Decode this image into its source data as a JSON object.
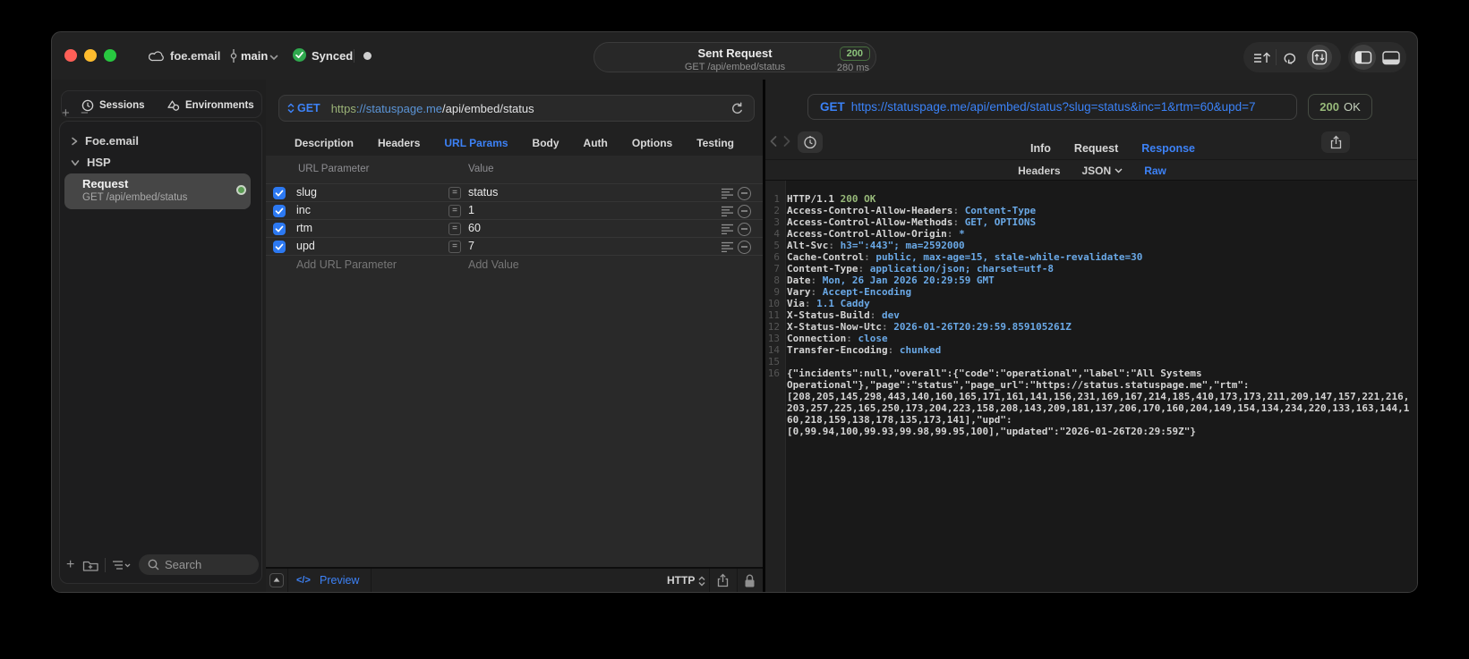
{
  "titlebar": {
    "project": "foe.email",
    "branch": "main",
    "sync_status": "Synced",
    "center": {
      "title": "Sent Request",
      "subtitle": "GET /api/embed/status",
      "status_code": "200",
      "duration": "280 ms"
    }
  },
  "sidebar": {
    "tabs": [
      {
        "label": "Sessions"
      },
      {
        "label": "Environments"
      }
    ],
    "tree": [
      {
        "label": "Foe.email"
      },
      {
        "label": "HSP"
      }
    ],
    "request_item": {
      "title": "Request",
      "subtitle": "GET /api/embed/status"
    },
    "search_placeholder": "Search"
  },
  "request_pane": {
    "method": "GET",
    "url_scheme": "https",
    "url_host": "://statuspage.me",
    "url_path": "/api/embed/status",
    "tabs": [
      "Description",
      "Headers",
      "URL Params",
      "Body",
      "Auth",
      "Options",
      "Testing"
    ],
    "active_tab": "URL Params",
    "table": {
      "col1": "URL Parameter",
      "col2": "Value",
      "rows": [
        {
          "name": "slug",
          "value": "status"
        },
        {
          "name": "inc",
          "value": "1"
        },
        {
          "name": "rtm",
          "value": "60"
        },
        {
          "name": "upd",
          "value": "7"
        }
      ],
      "add_name": "Add URL Parameter",
      "add_value": "Add Value"
    },
    "footer": {
      "code_glyph": "</>",
      "preview_label": "Preview",
      "protocol": "HTTP"
    }
  },
  "response_pane": {
    "method": "GET",
    "url": "https://statuspage.me/api/embed/status?slug=status&inc=1&rtm=60&upd=7",
    "status_code": "200",
    "status_text": "OK",
    "tabs": [
      "Info",
      "Request",
      "Response"
    ],
    "active_tab": "Response",
    "subtabs": [
      "Headers",
      "JSON",
      "Raw"
    ],
    "active_subtab": "Raw",
    "http_line": {
      "protocol": "HTTP/1.1",
      "status": "200 OK"
    },
    "headers": [
      {
        "name": "Access-Control-Allow-Headers",
        "value": "Content-Type"
      },
      {
        "name": "Access-Control-Allow-Methods",
        "value": "GET, OPTIONS"
      },
      {
        "name": "Access-Control-Allow-Origin",
        "value": "*"
      },
      {
        "name": "Alt-Svc",
        "value": "h3=\":443\"; ma=2592000"
      },
      {
        "name": "Cache-Control",
        "value": "public, max-age=15, stale-while-revalidate=30"
      },
      {
        "name": "Content-Type",
        "value": "application/json; charset=utf-8"
      },
      {
        "name": "Date",
        "value": "Mon, 26 Jan 2026 20:29:59 GMT"
      },
      {
        "name": "Vary",
        "value": "Accept-Encoding"
      },
      {
        "name": "Via",
        "value": "1.1 Caddy"
      },
      {
        "name": "X-Status-Build",
        "value": "dev"
      },
      {
        "name": "X-Status-Now-Utc",
        "value": "2026-01-26T20:29:59.859105261Z"
      },
      {
        "name": "Connection",
        "value": "close"
      },
      {
        "name": "Transfer-Encoding",
        "value": "chunked"
      }
    ],
    "body_lines": [
      "{\"incidents\":null,\"overall\":{\"code\":\"operational\",\"label\":\"All Systems",
      "Operational\"},\"page\":\"status\",\"page_url\":\"https://status.statuspage.me\",\"rtm\":",
      "[208,205,145,298,443,140,160,165,171,161,141,156,231,169,167,214,185,410,173,173,211,209,147,157,221,216,",
      "203,257,225,165,250,173,204,223,158,208,143,209,181,137,206,170,160,204,149,154,134,234,220,133,163,144,1",
      "60,218,159,138,178,135,173,141],\"upd\":",
      "[0,99.94,100,99.93,99.98,99.95,100],\"updated\":\"2026-01-26T20:29:59Z\"}"
    ]
  },
  "colors": {
    "accent_blue": "#3d82f7",
    "value_blue": "#6aa9e7",
    "green": "#98ba7a",
    "checkbox_blue": "#2c79f2"
  },
  "icons": [
    "cloud-icon",
    "branch-icon",
    "chevron-down-icon",
    "synced-check-icon",
    "window-dot-icon",
    "export-lines-icon",
    "loop-icon",
    "import-export-icon",
    "sidebar-toggle-icon",
    "bottom-panel-toggle-icon",
    "clock-icon",
    "shapes-icon",
    "plus-icon",
    "minus-icon",
    "disclosure-chevron",
    "green-status-dot",
    "new-folder-icon",
    "list-options-icon",
    "search-icon",
    "updown-icon",
    "refresh-icon",
    "equals-icon",
    "reorder-lines-icon",
    "remove-circle-icon",
    "collapse-icon",
    "code-icon",
    "share-icon",
    "lock-icon",
    "back-icon",
    "forward-icon",
    "history-clock-icon",
    "json-chevron-icon"
  ]
}
